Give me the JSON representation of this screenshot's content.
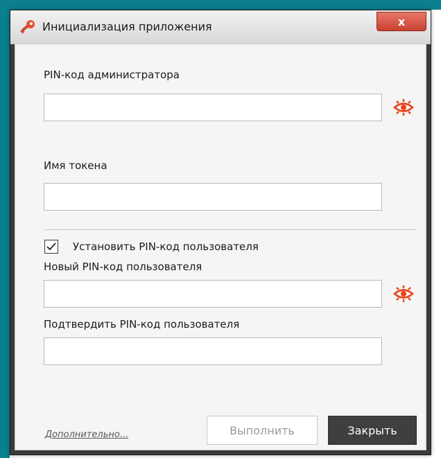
{
  "window": {
    "title": "Инициализация приложения",
    "close_label": "x"
  },
  "form": {
    "admin_pin_label": "PIN-код администратора",
    "admin_pin_value": "",
    "token_name_label": "Имя токена",
    "token_name_value": "",
    "set_user_pin_label": "Установить PIN-код пользователя",
    "set_user_pin_checked": true,
    "new_user_pin_label": "Новый PIN-код пользователя",
    "new_user_pin_value": "",
    "confirm_user_pin_label": "Подтвердить PIN-код пользователя",
    "confirm_user_pin_value": ""
  },
  "footer": {
    "more_link": "Дополнительно...",
    "execute_label": "Выполнить",
    "execute_enabled": false,
    "close_label": "Закрыть"
  },
  "colors": {
    "accent_eye": "#e8431c",
    "titlebar_close": "#c8412f",
    "dark_button": "#3f3f3f",
    "desktop": "#0b7f8f"
  },
  "icons": {
    "title": "key-icon",
    "show_password": "eye-icon",
    "checkbox": "checkmark-icon"
  }
}
